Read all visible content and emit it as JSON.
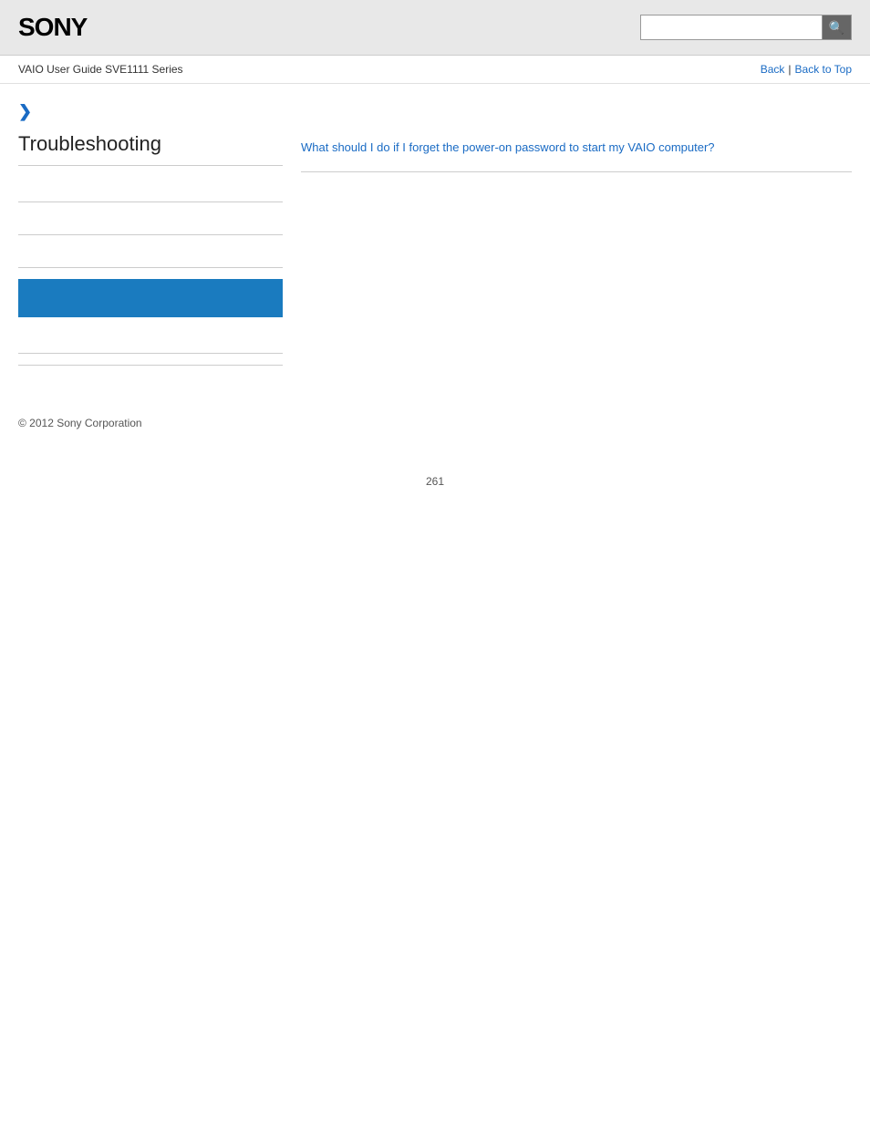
{
  "header": {
    "logo": "SONY",
    "search_placeholder": ""
  },
  "breadcrumb": {
    "guide_title": "VAIO User Guide SVE1111 Series",
    "back_label": "Back",
    "separator": "|",
    "back_to_top_label": "Back to Top"
  },
  "sidebar": {
    "chevron": "❯",
    "title": "Troubleshooting",
    "items": [
      "",
      "",
      "",
      "",
      ""
    ],
    "button_label": ""
  },
  "content": {
    "link_text": "What should I do if I forget the power-on password to start my VAIO computer?"
  },
  "footer": {
    "copyright": "© 2012 Sony Corporation"
  },
  "page_number": "261",
  "colors": {
    "accent_blue": "#1a6bc4",
    "button_blue": "#1a7bbf",
    "header_bg": "#e8e8e8"
  }
}
